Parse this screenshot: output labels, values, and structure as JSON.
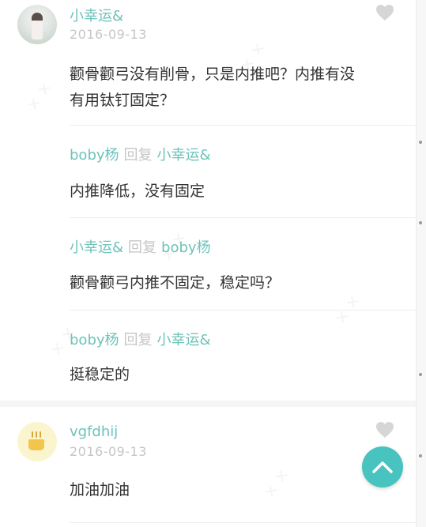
{
  "comments": [
    {
      "username": "小幸运&",
      "date": "2016-09-13",
      "text_line1": "颧骨颧弓没有削骨，只是内推吧？内推有没",
      "text_line2": "有用钛钉固定？",
      "replies": [
        {
          "from": "boby杨",
          "verb": "回复",
          "to": "小幸运&",
          "text": "内推降低，没有固定"
        },
        {
          "from": "小幸运&",
          "verb": "回复",
          "to": "boby杨",
          "text": "颧骨颧弓内推不固定，稳定吗？"
        },
        {
          "from": "boby杨",
          "verb": "回复",
          "to": "小幸运&",
          "text": "挺稳定的"
        }
      ]
    },
    {
      "username": "vgfdhij",
      "date": "2016-09-13",
      "text_line1": "加油加油"
    }
  ],
  "icons": {
    "like": "heart-icon",
    "scroll_top": "chevron-up-icon"
  },
  "colors": {
    "accent": "#6dc3ba",
    "button": "#48c3c0",
    "muted": "#c6c6c6",
    "text": "#333333"
  }
}
